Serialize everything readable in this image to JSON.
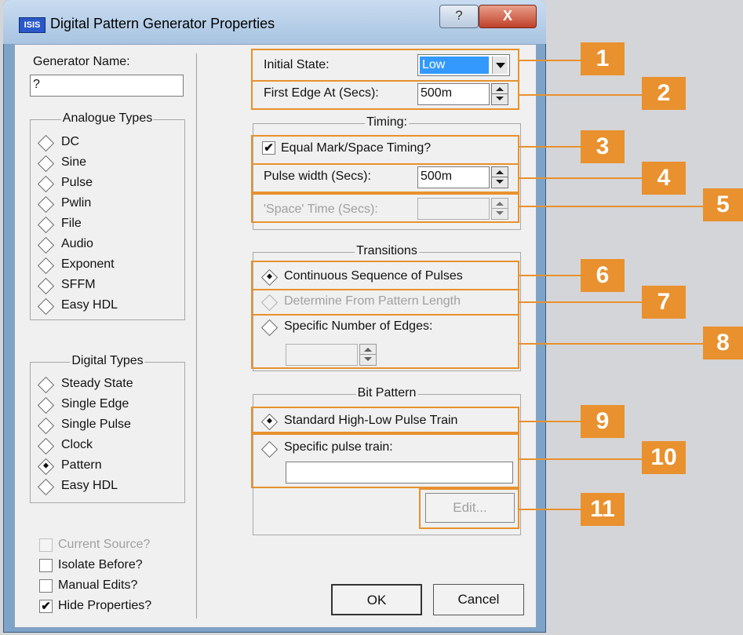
{
  "window": {
    "title": "Digital Pattern Generator Properties",
    "app_icon": "ISIS",
    "help_label": "?",
    "close_label": "X"
  },
  "left": {
    "generator_name_label": "Generator Name:",
    "generator_name_value": "?",
    "analogue_title": "Analogue Types",
    "analogue_items": [
      "DC",
      "Sine",
      "Pulse",
      "Pwlin",
      "File",
      "Audio",
      "Exponent",
      "SFFM",
      "Easy HDL"
    ],
    "digital_title": "Digital Types",
    "digital_items": [
      "Steady State",
      "Single Edge",
      "Single Pulse",
      "Clock",
      "Pattern",
      "Easy HDL"
    ],
    "digital_selected": "Pattern",
    "checks": [
      {
        "label": "Current Source?",
        "checked": false,
        "disabled": true
      },
      {
        "label": "Isolate Before?",
        "checked": false,
        "disabled": false
      },
      {
        "label": "Manual Edits?",
        "checked": false,
        "disabled": false
      },
      {
        "label": "Hide Properties?",
        "checked": true,
        "disabled": false
      }
    ]
  },
  "right": {
    "initial_state_label": "Initial State:",
    "initial_state_value": "Low",
    "first_edge_label": "First Edge At (Secs):",
    "first_edge_value": "500m",
    "timing_title": "Timing:",
    "equal_mark_label": "Equal Mark/Space Timing?",
    "equal_mark_checked": true,
    "pulse_width_label": "Pulse width (Secs):",
    "pulse_width_value": "500m",
    "space_time_label": "'Space' Time (Secs):",
    "transitions_title": "Transitions",
    "continuous_label": "Continuous Sequence of Pulses",
    "determine_label": "Determine From Pattern Length",
    "specific_edges_label": "Specific Number of Edges:",
    "bit_pattern_title": "Bit Pattern",
    "standard_label": "Standard High-Low Pulse Train",
    "specific_train_label": "Specific pulse train:",
    "edit_label": "Edit...",
    "ok_label": "OK",
    "cancel_label": "Cancel"
  },
  "callouts": [
    "1",
    "2",
    "3",
    "4",
    "5",
    "6",
    "7",
    "8",
    "9",
    "10",
    "11"
  ],
  "colors": {
    "callout": "#e8912e",
    "dropdown_selected": "#3399ff"
  }
}
